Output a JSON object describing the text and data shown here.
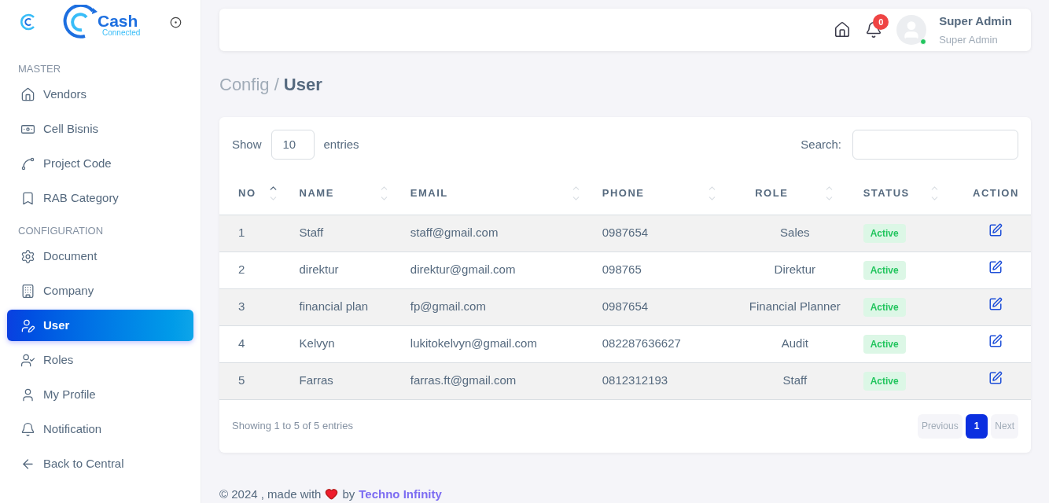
{
  "brand": {
    "name": "Cash",
    "tagline": "Connected"
  },
  "sidebar": {
    "sections": [
      {
        "title": "MASTER",
        "items": [
          {
            "label": "Vendors",
            "selected": false
          },
          {
            "label": "Cell Bisnis",
            "selected": false
          },
          {
            "label": "Project Code",
            "selected": false
          },
          {
            "label": "RAB Category",
            "selected": false
          }
        ]
      },
      {
        "title": "CONFIGURATION",
        "items": [
          {
            "label": "Document",
            "selected": false
          },
          {
            "label": "Company",
            "selected": false
          },
          {
            "label": "User",
            "selected": true
          },
          {
            "label": "Roles",
            "selected": false
          },
          {
            "label": "My Profile",
            "selected": false
          },
          {
            "label": "Notification",
            "selected": false
          },
          {
            "label": "Back to Central",
            "selected": false
          }
        ]
      }
    ]
  },
  "header": {
    "notification_count": "0",
    "user_name": "Super Admin",
    "user_role": "Super Admin",
    "online": true
  },
  "breadcrumb": {
    "parent": "Config /",
    "current": "User"
  },
  "table": {
    "length_label_before": "Show",
    "length_value": "10",
    "length_label_after": "entries",
    "search_label": "Search:",
    "columns": [
      {
        "label": "NO",
        "sortable": true,
        "sorted": true
      },
      {
        "label": "NAME",
        "sortable": true,
        "sorted": false
      },
      {
        "label": "EMAIL",
        "sortable": true,
        "sorted": false
      },
      {
        "label": "PHONE",
        "sortable": true,
        "sorted": false
      },
      {
        "label": "ROLE",
        "sortable": true,
        "sorted": false
      },
      {
        "label": "STATUS",
        "sortable": true,
        "sorted": false
      },
      {
        "label": "ACTION"
      }
    ],
    "rows": [
      {
        "no": "1",
        "name": "Staff",
        "email": "staff@gmail.com",
        "phone": "0987654",
        "role": "Sales",
        "status": "Active"
      },
      {
        "no": "2",
        "name": "direktur",
        "email": "direktur@gmail.com",
        "phone": "098765",
        "role": "Direktur",
        "status": "Active"
      },
      {
        "no": "3",
        "name": "financial plan",
        "email": "fp@gmail.com",
        "phone": "0987654",
        "role": "Financial Planner",
        "status": "Active"
      },
      {
        "no": "4",
        "name": "Kelvyn",
        "email": "lukitokelvyn@gmail.com",
        "phone": "082287636627",
        "role": "Audit",
        "status": "Active"
      },
      {
        "no": "5",
        "name": "Farras",
        "email": "farras.ft@gmail.com",
        "phone": "0812312193",
        "role": "Staff",
        "status": "Active"
      }
    ],
    "info": "Showing 1 to 5 of 5 entries",
    "pagination": [
      {
        "label": "Previous",
        "selected": false
      },
      {
        "label": "1",
        "selected": true
      },
      {
        "label": "Next",
        "selected": false
      }
    ]
  },
  "footer": {
    "text": "© 2024 , made with",
    "by": "by",
    "link": "Techno Infinity"
  }
}
